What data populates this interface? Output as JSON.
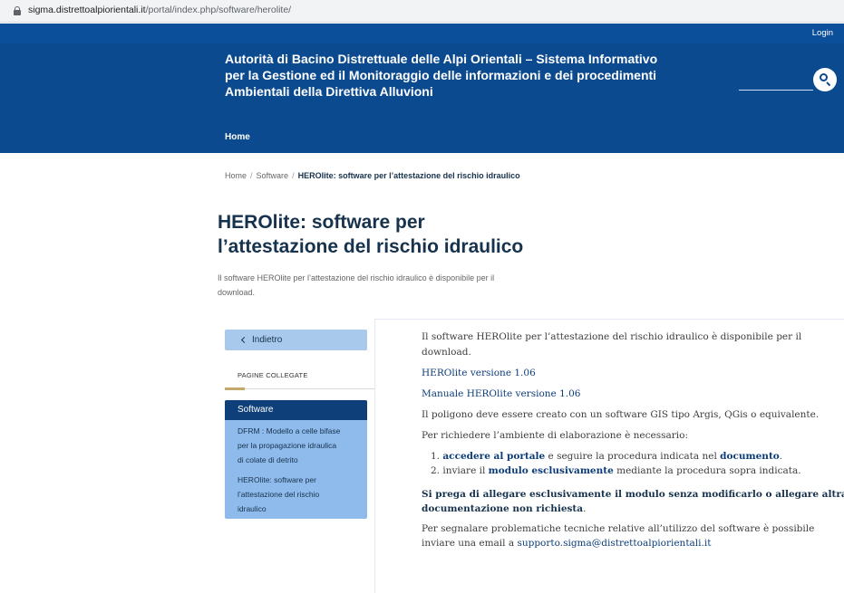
{
  "browser": {
    "url_host": "sigma.distrettoalpiorientali.it",
    "url_path": "/portal/index.php/software/herolite/"
  },
  "topbar": {
    "login": "Login"
  },
  "header": {
    "title_line1": "Autorità di Bacino Distrettuale delle Alpi Orientali – Sistema Informativo",
    "title_line2": "per la Gestione ed il Monitoraggio delle informazioni e dei procedimenti",
    "title_line3": "Ambientali della Direttiva Alluvioni",
    "nav_home": "Home"
  },
  "breadcrumb": {
    "home": "Home",
    "separator": "/",
    "software": "Software",
    "current": "HEROlite: software per l’attestazione del rischio idraulico"
  },
  "page": {
    "title_line1": "HEROlite: software per",
    "title_line2": "l’attestazione del rischio idraulico",
    "intro_line1": "Il software HEROlite per l’attestazione del rischio idraulico è disponibile per il",
    "intro_line2": "download."
  },
  "sidebar": {
    "back_label": "Indietro",
    "related_label": "PAGINE COLLEGATE",
    "menu_header": "Software",
    "items": [
      {
        "line1": "DFRM : Modello a celle bifase",
        "line2": "per la propagazione idraulica",
        "line3": "di colate di detrito"
      },
      {
        "line1": "HEROlite: software per",
        "line2": "l’attestazione del rischio",
        "line3": "idraulico"
      }
    ]
  },
  "content": {
    "p1_line1": "Il software HEROlite per l’attestazione del rischio idraulico è disponibile per il",
    "p1_line2": "download.",
    "link_version": "HEROlite versione 1.06",
    "link_manual": "Manuale HEROlite versione 1.06",
    "p2": "Il poligono deve essere creato con un software GIS tipo Argis, QGis o equivalente.",
    "p3": "Per richiedere l’ambiente di elaborazione è necessario:",
    "li1_num": "1.",
    "li1_link1": "accedere al portale",
    "li1_mid": " e seguire la procedura indicata nel ",
    "li1_link2": "documento",
    "li1_end": ".",
    "li2_num": "2.",
    "li2_start": "inviare il ",
    "li2_bold": "modulo esclusivamente",
    "li2_end": " mediante la procedura sopra indicata.",
    "warn_line1": "Si prega di allegare esclusivamente il modulo senza modificarlo o allegare altra",
    "warn_line2_bold": "documentazione non richiesta",
    "warn_line2_end": ".",
    "support_line1": "Per segnalare problematiche tecniche relative all’utilizzo del software è possibile",
    "support_line2_start": "inviare una email a ",
    "support_email": "supporto.sigma@distrettoalpiorientali.it"
  }
}
